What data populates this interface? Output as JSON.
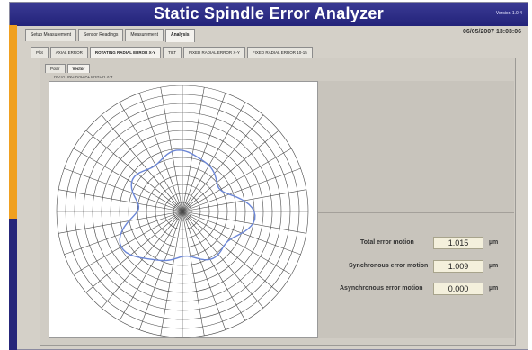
{
  "app": {
    "title": "Static Spindle Error Analyzer",
    "version": "Version 1.0.4",
    "datetime": "06/05/2007  13:03:06"
  },
  "main_tabs": [
    {
      "label": "Setup Measurement",
      "active": false
    },
    {
      "label": "Sensor Readings",
      "active": false
    },
    {
      "label": "Measurement",
      "active": false
    },
    {
      "label": "Analysis",
      "active": true
    }
  ],
  "sub_tabs": [
    {
      "label": "Plot",
      "active": false
    },
    {
      "label": "AXIAL ERROR",
      "active": false
    },
    {
      "label": "ROTATING RADIAL ERROR X-Y",
      "active": true
    },
    {
      "label": "TILT",
      "active": false
    },
    {
      "label": "FIXED RADIAL ERROR X-Y",
      "active": false
    },
    {
      "label": "FIXED RADIAL ERROR 10-15",
      "active": false
    }
  ],
  "view_tabs": [
    {
      "label": "Polar",
      "active": false
    },
    {
      "label": "Vector",
      "active": true
    }
  ],
  "graph_label": "ROTATING RADIAL ERROR X-Y",
  "metrics": {
    "total": {
      "label": "Total error motion",
      "value": "1.015",
      "unit": "µm"
    },
    "synchronous": {
      "label": "Synchronous error motion",
      "value": "1.009",
      "unit": "µm"
    },
    "asynchronous": {
      "label": "Asynchronous error motion",
      "value": "0.000",
      "unit": "µm"
    }
  },
  "colors": {
    "titlebar": "#2b2b86",
    "accent_orange": "#f0a020",
    "trace": "#6b86d6",
    "grid": "#4a4a4a"
  }
}
